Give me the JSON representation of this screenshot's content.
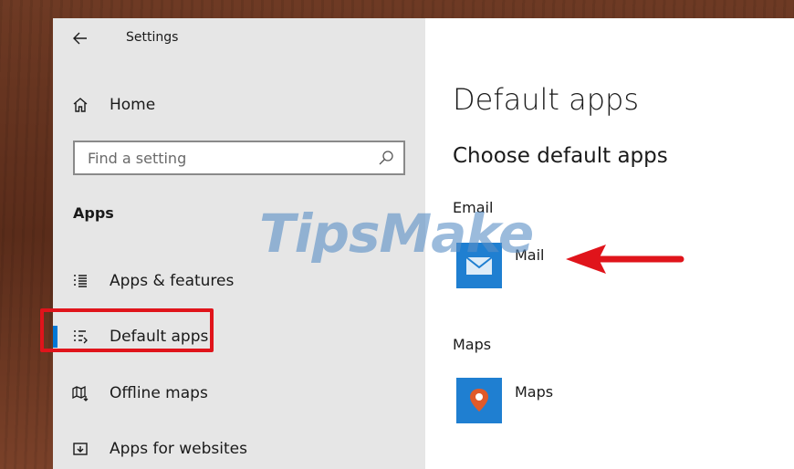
{
  "window": {
    "title": "Settings"
  },
  "sidebar": {
    "home_label": "Home",
    "search": {
      "placeholder": "Find a setting",
      "value": ""
    },
    "section_heading": "Apps",
    "items": [
      {
        "label": "Apps & features",
        "icon": "apps-features-icon"
      },
      {
        "label": "Default apps",
        "icon": "default-apps-icon",
        "selected": true
      },
      {
        "label": "Offline maps",
        "icon": "offline-maps-icon"
      },
      {
        "label": "Apps for websites",
        "icon": "apps-websites-icon"
      }
    ]
  },
  "main": {
    "page_title": "Default apps",
    "subheading": "Choose default apps",
    "categories": [
      {
        "label": "Email",
        "app_name": "Mail",
        "tile_color": "#1f7fd1"
      },
      {
        "label": "Maps",
        "app_name": "Maps",
        "tile_color": "#1f7fd1"
      }
    ]
  },
  "watermark": "TipsMake",
  "colors": {
    "accent": "#0078d7",
    "annotation_red": "#e0141b"
  }
}
